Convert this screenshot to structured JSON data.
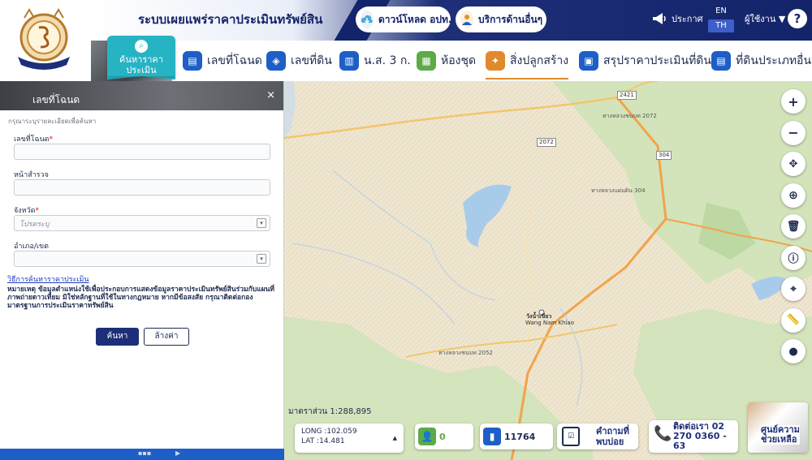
{
  "header": {
    "site_title": "ระบบเผยแพร่ราคาประเมินทรัพย์สิน",
    "download_label": "ดาวน์โหลด อปท.",
    "other_services_label": "บริการด้านอื่นๆ",
    "announce_label": "ประกาศ",
    "lang_en": "EN",
    "lang_th": "TH",
    "user_label": "ผู้ใช้งาน",
    "help_label": "?"
  },
  "nav": {
    "search_tab_line1": "ค้นหาราคา",
    "search_tab_line2": "ประเมิน",
    "items": [
      {
        "label": "เลขที่โฉนด",
        "icon": "deed-icon"
      },
      {
        "label": "เลขที่ดิน",
        "icon": "layers-icon"
      },
      {
        "label": "น.ส. 3 ก.",
        "icon": "map-icon"
      },
      {
        "label": "ห้องชุด",
        "icon": "building-icon"
      },
      {
        "label": "สิ่งปลูกสร้าง",
        "icon": "handshake-icon"
      },
      {
        "label": "สรุปราคาประเมินที่ดิน",
        "icon": "money-icon"
      },
      {
        "label": "ที่ดินประเภทอื่น",
        "icon": "document-icon"
      }
    ],
    "active_index": 4
  },
  "panel": {
    "title": "เลขที่โฉนด",
    "close_label": "×",
    "hint": "กรุณาระบุรายละเอียดเพื่อค้นหา",
    "fields": {
      "deed_label": "เลขที่โฉนด",
      "survey_label": "หน้าสำรวจ",
      "province_label": "จังหวัด",
      "province_placeholder": "โปรดระบุ",
      "district_label": "อำเภอ/เขต"
    },
    "method_link": "วิธีการค้นหาราคาประเมิน",
    "remark": "หมายเหตุ ข้อมูลตำแหน่งใช้เพื่อประกอบการแสดงข้อมูลราคาประเมินทรัพย์สินร่วมกับแผนที่ภาพถ่ายดาวเทียม มิใช่หลักฐานที่ใช้ในทางกฎหมาย หากมีข้อสงสัย กรุณาติดต่อกอง มาตรฐานการประเมินราคาทรัพย์สิน",
    "search_button": "ค้นหา",
    "clear_button": "ล้างค่า"
  },
  "map": {
    "scale_label": "มาตราส่วน 1:288,895",
    "place_name_th": "วังน้ำเขียว",
    "place_name_en": "Wang Nam Khiao",
    "road_2421": "2421",
    "road_2072": "2072",
    "road_304": "304",
    "road_label_2072": "ทางหลวงชนบท 2072",
    "road_label_304": "ทางหลวงแผ่นดิน 304",
    "road_label_2052": "ทางหลวงชนบท 2052"
  },
  "bottom": {
    "long_label": "LONG :102.059",
    "lat_label": "LAT :14.481",
    "user_count": "0",
    "view_count": "11764",
    "faq_line1": "คำถามที่",
    "faq_line2": "พบบ่อย",
    "contact_line1": "ติดต่อเรา 02",
    "contact_line2": "270 0360 -",
    "contact_line3": "63",
    "help_line1": "ศูนย์ความ",
    "help_line2": "ช่วยเหลือ"
  },
  "colors": {
    "brand_navy": "#14246a",
    "accent_teal": "#26b3c4",
    "active_underline": "#e08a2c"
  }
}
